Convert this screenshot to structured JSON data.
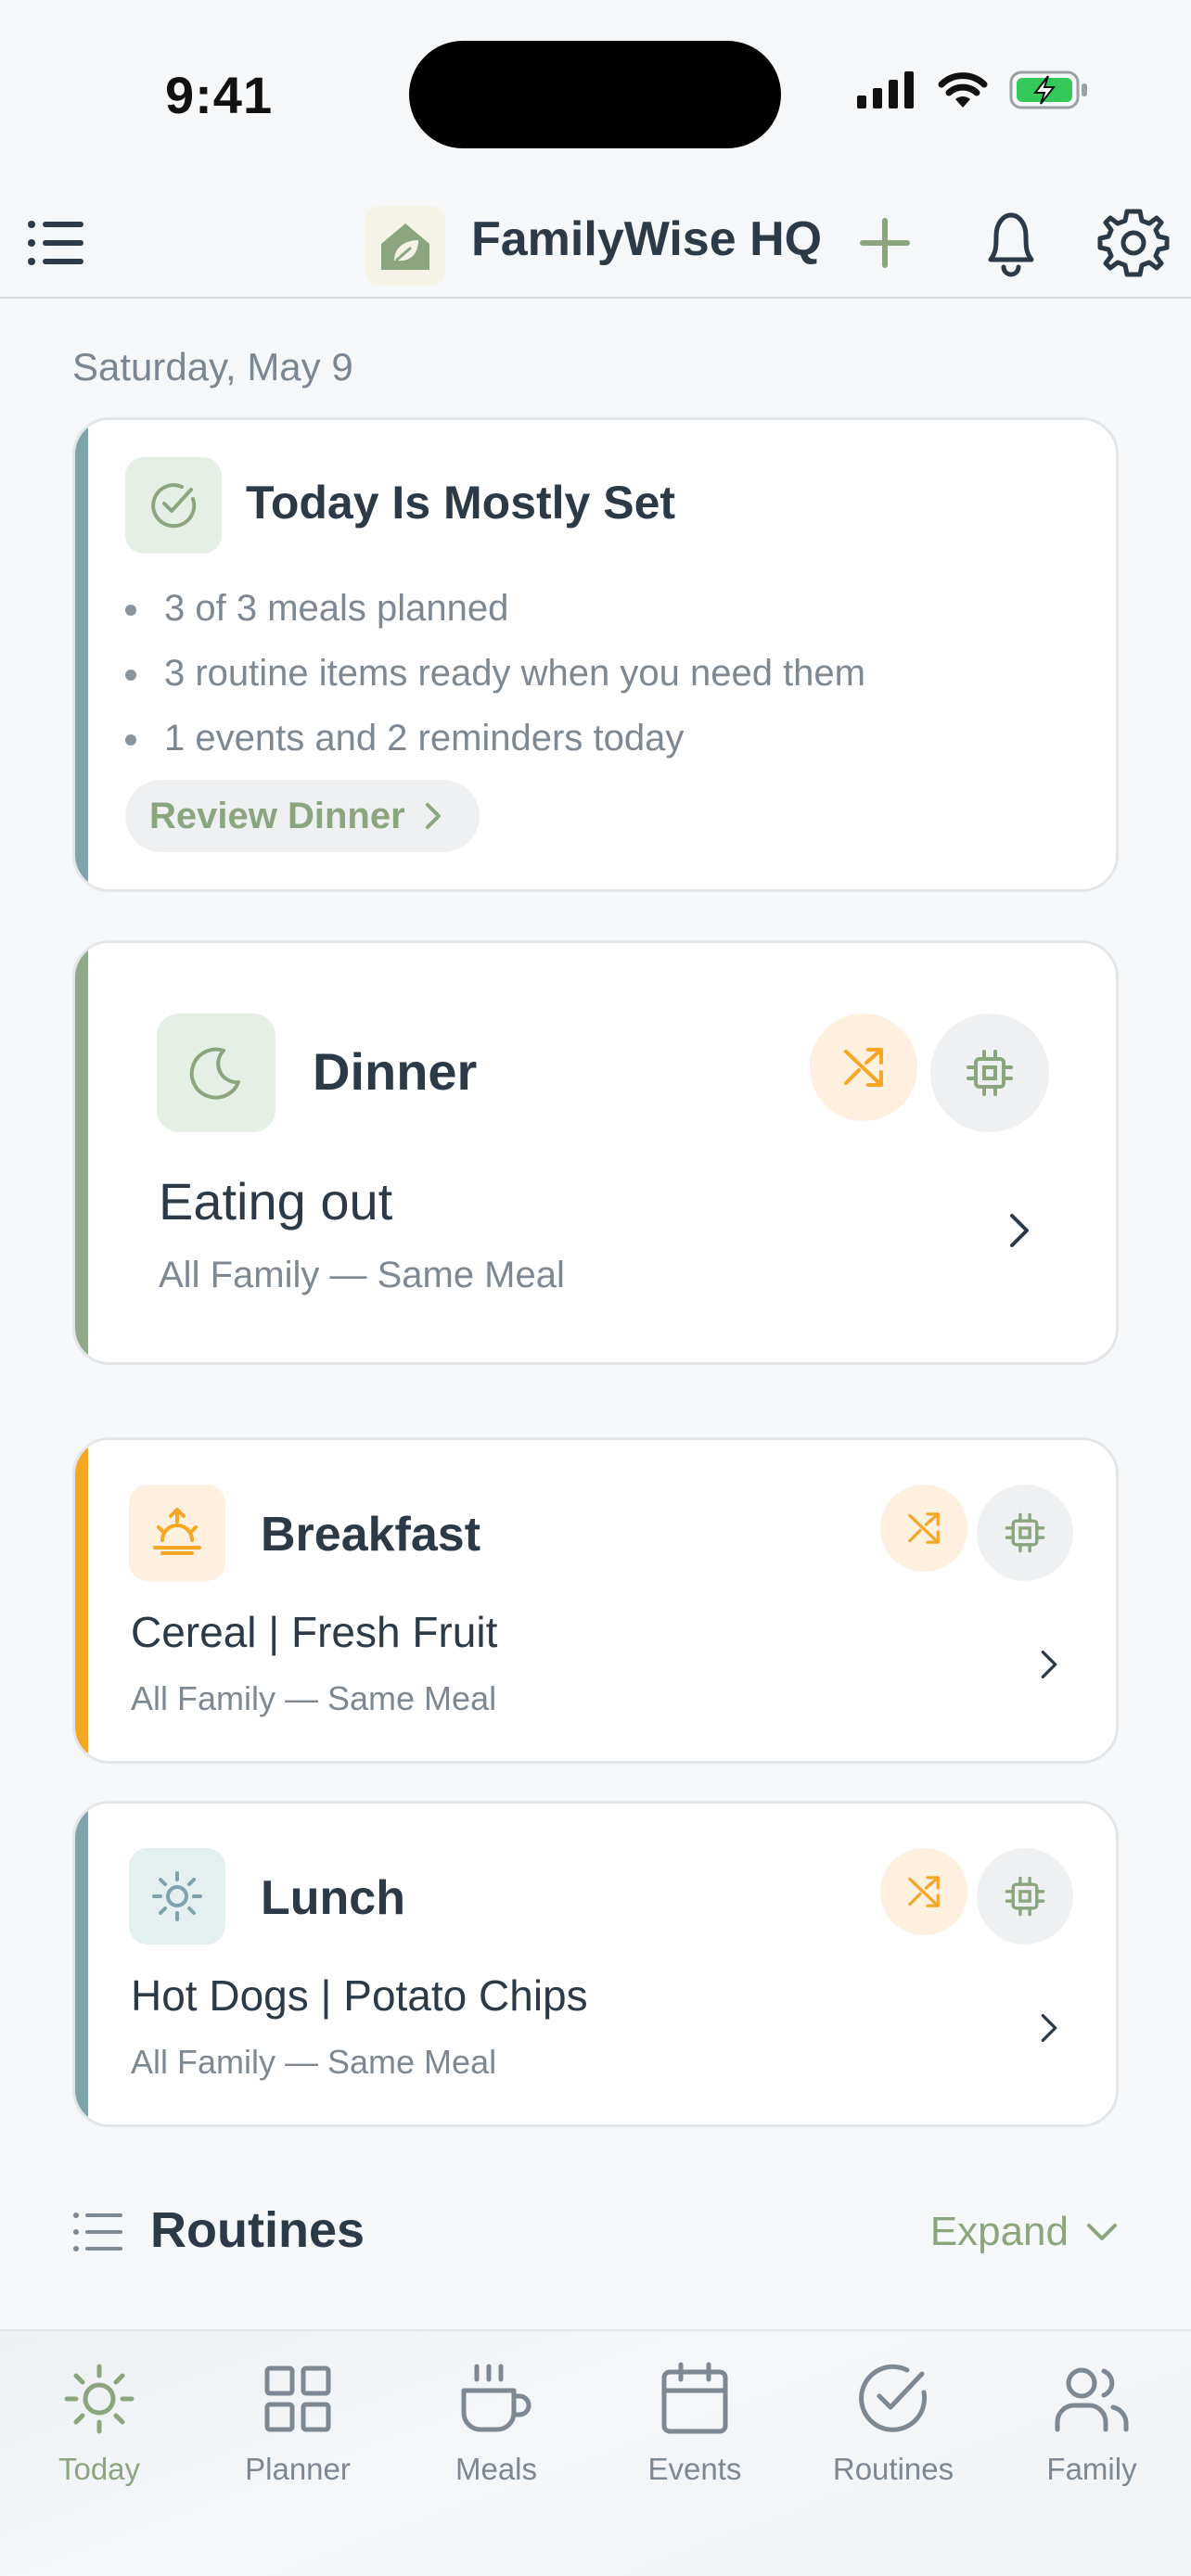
{
  "status_bar": {
    "time": "9:41"
  },
  "header": {
    "title": "FamilyWise HQ"
  },
  "date": "Saturday, May 9",
  "summary": {
    "title": "Today Is Mostly Set",
    "bullets": [
      "3 of 3 meals planned",
      "3 routine items ready when you need them",
      "1 events and 2 reminders today"
    ],
    "action_label": "Review Dinner"
  },
  "meals": {
    "dinner": {
      "name": "Dinner",
      "food": "Eating out",
      "audience": "All Family — Same Meal",
      "accent": "#8fa887"
    },
    "breakfast": {
      "name": "Breakfast",
      "food": "Cereal | Fresh Fruit",
      "audience": "All Family — Same Meal",
      "accent": "#f5a623"
    },
    "lunch": {
      "name": "Lunch",
      "food": "Hot Dogs | Potato Chips",
      "audience": "All Family — Same Meal",
      "accent": "#7fa3ab"
    }
  },
  "routines": {
    "title": "Routines",
    "expand_label": "Expand"
  },
  "tabs": [
    {
      "label": "Today",
      "icon": "sun-icon",
      "active": true
    },
    {
      "label": "Planner",
      "icon": "grid-icon",
      "active": false
    },
    {
      "label": "Meals",
      "icon": "cup-icon",
      "active": false
    },
    {
      "label": "Events",
      "icon": "calendar-icon",
      "active": false
    },
    {
      "label": "Routines",
      "icon": "check-circle-icon",
      "active": false
    },
    {
      "label": "Family",
      "icon": "users-icon",
      "active": false
    }
  ],
  "colors": {
    "brand_green": "#8ba67f",
    "summary_accent": "#7fa3ab",
    "shuffle_orange": "#f5a623"
  }
}
